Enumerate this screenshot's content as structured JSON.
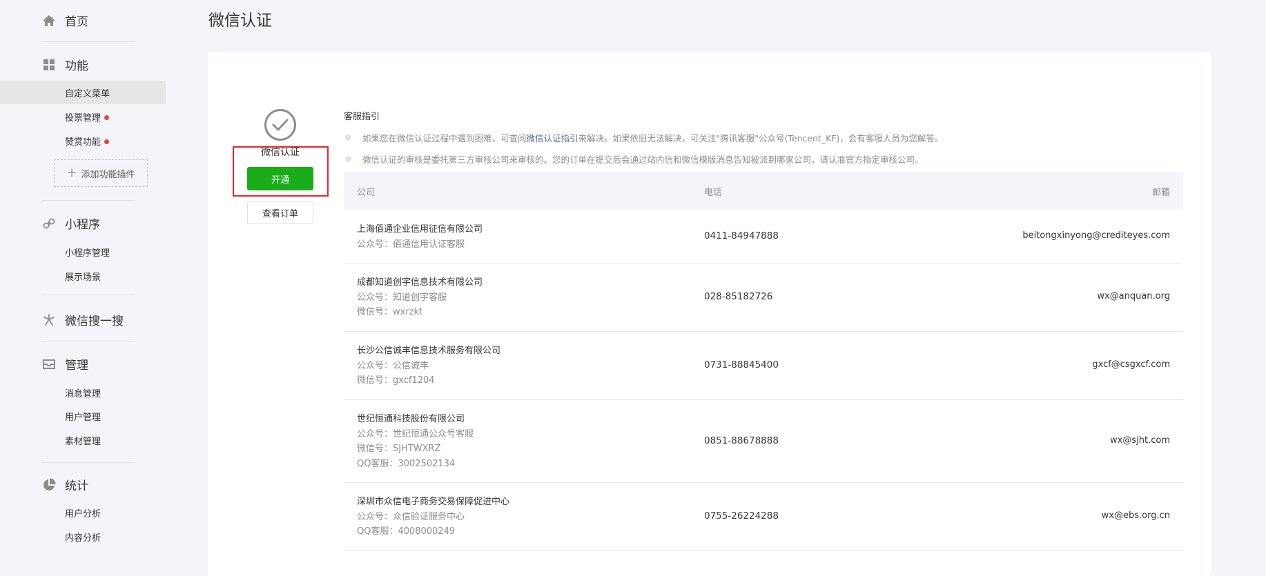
{
  "sidebar": {
    "home": "首页",
    "function": "功能",
    "function_items": [
      "自定义菜单",
      "投票管理",
      "赞赏功能"
    ],
    "add_plugin": "添加功能插件",
    "miniprogram": "小程序",
    "miniprogram_items": [
      "小程序管理",
      "展示场景"
    ],
    "search": "微信搜一搜",
    "manage": "管理",
    "manage_items": [
      "消息管理",
      "用户管理",
      "素材管理"
    ],
    "stats": "统计",
    "stats_items": [
      "用户分析",
      "内容分析"
    ]
  },
  "page_title": "微信认证",
  "cert": {
    "label": "微信认证",
    "open_button": "开通",
    "order_button": "查看订单"
  },
  "guide": {
    "title": "客服指引",
    "item1_pre": "如果您在微信认证过程中遇到困难，可查阅",
    "item1_link": "微信认证指引",
    "item1_post": "来解决。如果依旧无法解决，可关注\"腾讯客服\"公众号(Tencent_KF)，会有客服人员为您解答。",
    "item2": "微信认证的审核是委托第三方审核公司来审核的。您的订单在提交后会通过站内信和微信模版消息告知被派到哪家公司，请认准官方指定审核公司。"
  },
  "table": {
    "headers": {
      "company": "公司",
      "phone": "电话",
      "email": "邮箱"
    },
    "rows": [
      {
        "name": "上海佰通企业信用征信有限公司",
        "meta1": "公众号：佰通信用认证客服",
        "meta2": "",
        "meta3": "",
        "phone": "0411-84947888",
        "email": "beitongxinyong@crediteyes.com"
      },
      {
        "name": "成都知道创宇信息技术有限公司",
        "meta1": "公众号：知道创宇客服",
        "meta2": "微信号：wxrzkf",
        "meta3": "",
        "phone": "028-85182726",
        "email": "wx@anquan.org"
      },
      {
        "name": "长沙公信诚丰信息技术服务有限公司",
        "meta1": "公众号：公信诚丰",
        "meta2": "微信号：gxcf1204",
        "meta3": "",
        "phone": "0731-88845400",
        "email": "gxcf@csgxcf.com"
      },
      {
        "name": "世纪恒通科技股份有限公司",
        "meta1": "公众号：世纪恒通公众号客服",
        "meta2": "微信号：SJHTWXRZ",
        "meta3": "QQ客服：3002502134",
        "phone": "0851-88678888",
        "email": "wx@sjht.com"
      },
      {
        "name": "深圳市众信电子商务交易保障促进中心",
        "meta1": "公众号：众信验证服务中心",
        "meta2": "QQ客服：4008000249",
        "meta3": "",
        "phone": "0755-26224288",
        "email": "wx@ebs.org.cn"
      }
    ]
  }
}
